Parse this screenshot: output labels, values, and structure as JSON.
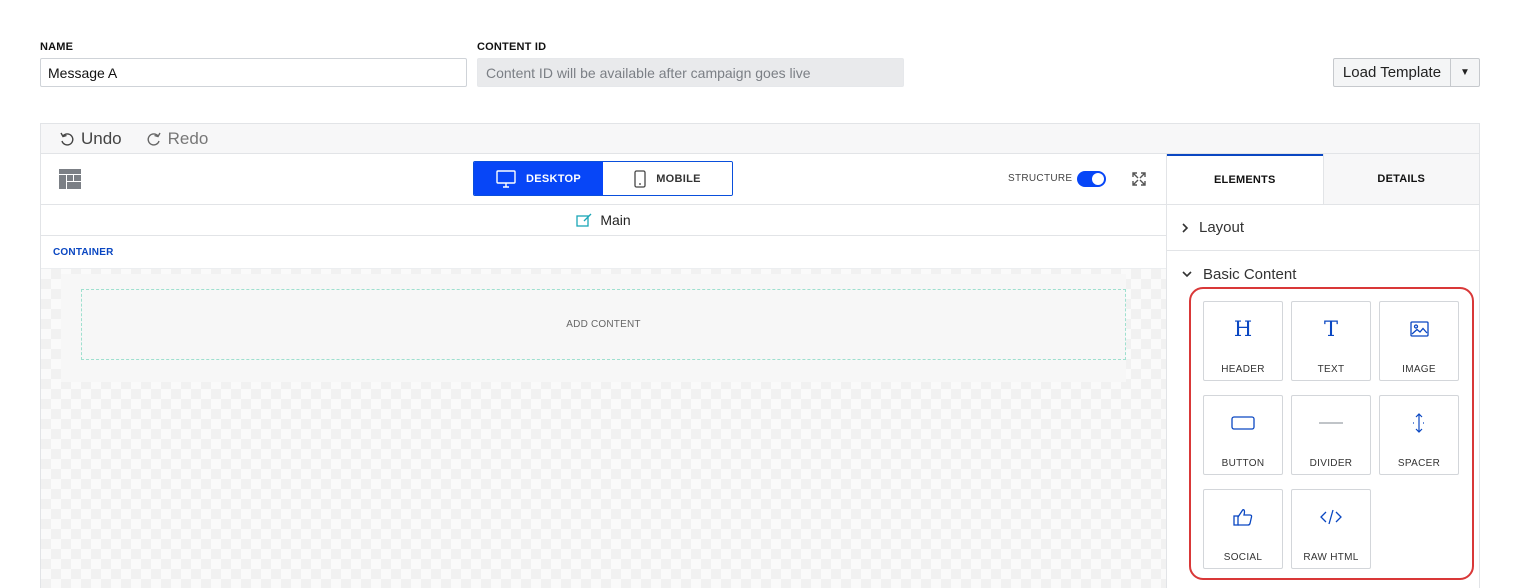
{
  "form": {
    "name_label": "NAME",
    "name_value": "Message A",
    "content_id_label": "CONTENT ID",
    "content_id_placeholder": "Content ID will be available after campaign goes live",
    "load_template_label": "Load Template"
  },
  "history": {
    "undo_label": "Undo",
    "redo_label": "Redo"
  },
  "toolbar": {
    "desktop_label": "DESKTOP",
    "mobile_label": "MOBILE",
    "active_device": "desktop",
    "structure_label": "STRUCTURE",
    "structure_enabled": true
  },
  "canvas": {
    "section_title": "Main",
    "container_label": "CONTAINER",
    "add_content_label": "ADD CONTENT"
  },
  "panel": {
    "tabs": [
      {
        "label": "ELEMENTS",
        "active": true
      },
      {
        "label": "DETAILS",
        "active": false
      }
    ],
    "layout_section": "Layout",
    "basic_content_section": "Basic Content",
    "elements": [
      {
        "label": "HEADER",
        "icon": "header-icon"
      },
      {
        "label": "TEXT",
        "icon": "text-icon"
      },
      {
        "label": "IMAGE",
        "icon": "image-icon"
      },
      {
        "label": "BUTTON",
        "icon": "button-icon"
      },
      {
        "label": "DIVIDER",
        "icon": "divider-icon"
      },
      {
        "label": "SPACER",
        "icon": "spacer-icon"
      },
      {
        "label": "SOCIAL",
        "icon": "social-icon"
      },
      {
        "label": "RAW HTML",
        "icon": "code-icon"
      }
    ]
  },
  "colors": {
    "accent": "#0746f7",
    "link_blue": "#0a47c2",
    "highlight_red": "#d93838",
    "dropzone_border": "#9fe0cf"
  }
}
